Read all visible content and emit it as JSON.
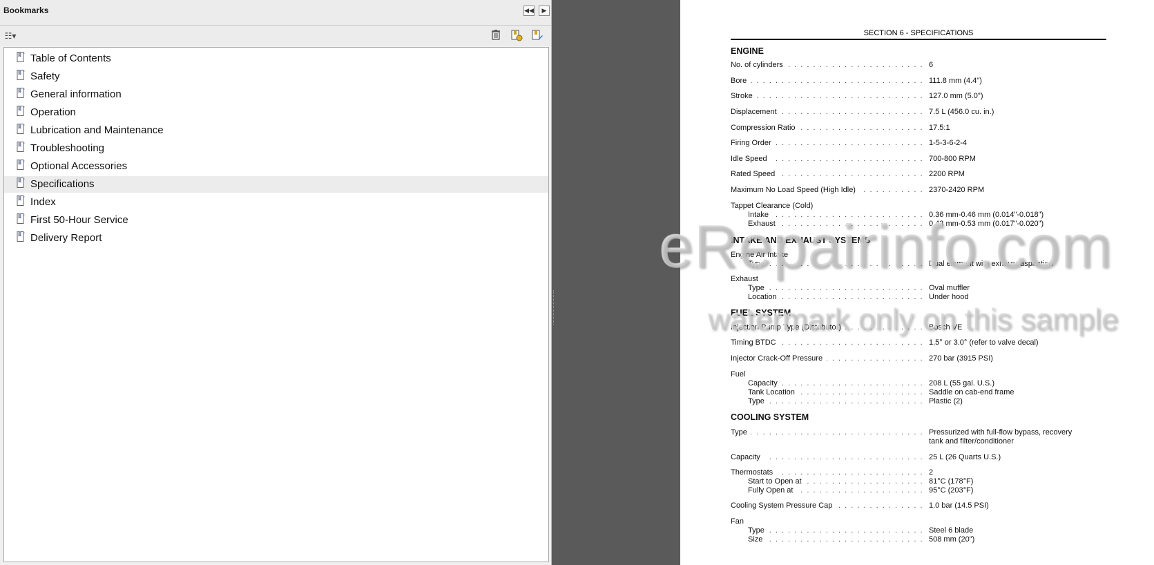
{
  "panel": {
    "title": "Bookmarks",
    "collapse_label": "◀◀",
    "expand_label": "▶",
    "options_label": "☷▾",
    "icons": [
      "options-icon",
      "delete-icon",
      "new-bookmark-icon",
      "bookmark-properties-icon"
    ]
  },
  "bookmarks": [
    {
      "label": "Table of Contents"
    },
    {
      "label": "Safety"
    },
    {
      "label": "General information"
    },
    {
      "label": "Operation"
    },
    {
      "label": "Lubrication and Maintenance"
    },
    {
      "label": "Troubleshooting"
    },
    {
      "label": "Optional Accessories"
    },
    {
      "label": "Specifications",
      "selected": true
    },
    {
      "label": "Index"
    },
    {
      "label": "First 50-Hour Service"
    },
    {
      "label": "Delivery Report"
    }
  ],
  "document": {
    "header": "SECTION 6 - SPECIFICATIONS",
    "sections": {
      "engine": "ENGINE",
      "intake": "INTAKE AND EXHAUST SYSTEMS",
      "fuel": "FUEL SYSTEM",
      "cooling": "COOLING SYSTEM"
    },
    "rows": [
      {
        "label": "No. of cylinders",
        "value": "6"
      },
      {
        "label": "Bore",
        "value": "111.8 mm (4.4\")"
      },
      {
        "label": "Stroke",
        "value": "127.0 mm (5.0\")"
      },
      {
        "label": "Displacement",
        "value": "7.5 L (456.0 cu. in.)"
      },
      {
        "label": "Compression Ratio",
        "value": "17.5:1"
      },
      {
        "label": "Firing Order",
        "value": "1-5-3-6-2-4"
      },
      {
        "label": "Idle Speed",
        "value": "700-800 RPM"
      },
      {
        "label": "Rated Speed",
        "value": "2200 RPM"
      },
      {
        "label": "Maximum No Load Speed (High Idle)",
        "value": "2370-2420 RPM"
      },
      {
        "label": "Tappet Clearance (Cold)",
        "value": ""
      },
      {
        "label": "Intake",
        "value": "0.36 mm-0.46 mm (0.014\"-0.018\")"
      },
      {
        "label": "Exhaust",
        "value": "0.43 mm-0.53 mm (0.017\"-0.020\")"
      },
      {
        "label": "Engine Air Intake",
        "value": ""
      },
      {
        "label": "Type",
        "value": "Dual element with exhaust aspiration"
      },
      {
        "label": "Exhaust",
        "value": ""
      },
      {
        "label": "Type",
        "value": "Oval muffler"
      },
      {
        "label": "Location",
        "value": "Under hood"
      },
      {
        "label": "Injection Pump Type (Distributor)",
        "value": "Bosch VE"
      },
      {
        "label": "Timing BTDC",
        "value": "1.5° or 3.0° (refer to valve decal)"
      },
      {
        "label": "Injector Crack-Off Pressure",
        "value": "270 bar (3915 PSI)"
      },
      {
        "label": "Fuel",
        "value": ""
      },
      {
        "label": "Capacity",
        "value": "208 L (55 gal. U.S.)"
      },
      {
        "label": "Tank Location",
        "value": "Saddle on cab-end frame"
      },
      {
        "label": "Type",
        "value": "Plastic (2)"
      },
      {
        "label": "Type",
        "value": "Pressurized with full-flow bypass, recovery"
      },
      {
        "label": "",
        "value": "tank and filter/conditioner"
      },
      {
        "label": "Capacity",
        "value": "25 L (26 Quarts U.S.)"
      },
      {
        "label": "Thermostats",
        "value": "2"
      },
      {
        "label": "Start to Open at",
        "value": "81°C (178°F)"
      },
      {
        "label": "Fully Open at",
        "value": "95°C (203°F)"
      },
      {
        "label": "Cooling System Pressure Cap",
        "value": "1.0 bar (14.5 PSI)"
      },
      {
        "label": "Fan",
        "value": ""
      },
      {
        "label": "Type",
        "value": "Steel 6 blade"
      },
      {
        "label": "Size",
        "value": "508 mm (20\")"
      }
    ],
    "watermark": {
      "line1": "eRepairinfo.com",
      "line2": "watermark only on this sample"
    }
  }
}
